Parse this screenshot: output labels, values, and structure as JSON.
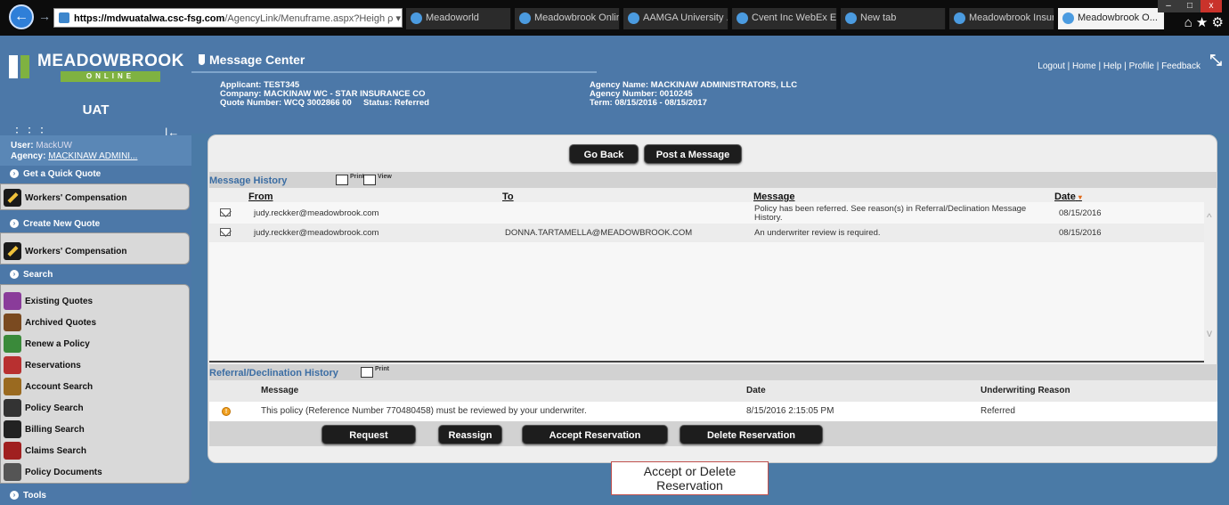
{
  "browser": {
    "url_host": "https://mdwuatalwa.csc-fsg.com",
    "url_path": "/AgencyLink/Menuframe.aspx?Heigh",
    "url_controls": "ρ ▾ 🔒 C",
    "tabs": [
      {
        "label": "Meadoworld",
        "active": false
      },
      {
        "label": "Meadowbrook Online...",
        "active": false
      },
      {
        "label": "AAMGA University ...",
        "active": false
      },
      {
        "label": "Cvent Inc WebEx Ent...",
        "active": false
      },
      {
        "label": "New tab",
        "active": false
      },
      {
        "label": "Meadowbrook Insur...",
        "active": false
      },
      {
        "label": "Meadowbrook O...",
        "active": true
      }
    ],
    "win_ctrls": [
      "–",
      "□",
      "x"
    ]
  },
  "sidebar": {
    "logo_name": "MEADOWBROOK",
    "logo_sub": "ONLINE",
    "env": "UAT",
    "user_label": "User:",
    "user_value": "MackUW",
    "agency_label": "Agency:",
    "agency_value": "MACKINAW ADMINI...",
    "sections": {
      "quick_quote": "Get a Quick Quote",
      "quick_quote_item": "Workers' Compensation",
      "new_quote": "Create New Quote",
      "new_quote_item": "Workers' Compensation",
      "search": "Search",
      "tools": "Tools"
    },
    "search_items": [
      {
        "label": "Existing Quotes",
        "icon": "existing-quotes-icon",
        "color": "#8a3c9a"
      },
      {
        "label": "Archived Quotes",
        "icon": "archived-quotes-icon",
        "color": "#7a4a20"
      },
      {
        "label": "Renew a Policy",
        "icon": "renew-policy-icon",
        "color": "#3a8a3a"
      },
      {
        "label": "Reservations",
        "icon": "reservations-icon",
        "color": "#b83030"
      },
      {
        "label": "Account Search",
        "icon": "account-search-icon",
        "color": "#9a6a20"
      },
      {
        "label": "Policy Search",
        "icon": "policy-search-icon",
        "color": "#333333"
      },
      {
        "label": "Billing Search",
        "icon": "billing-search-icon",
        "color": "#222222"
      },
      {
        "label": "Claims Search",
        "icon": "claims-search-icon",
        "color": "#a02020"
      },
      {
        "label": "Policy Documents",
        "icon": "policy-documents-icon",
        "color": "#555555"
      }
    ]
  },
  "header": {
    "title": "Message Center",
    "links": "Logout | Home | Help | Profile | Feedback",
    "applicant": "Applicant: TEST345",
    "company": "Company: MACKINAW WC - STAR INSURANCE CO",
    "quote_number": "Quote Number: WCQ 3002866 00",
    "status": "Status: Referred",
    "agency_name": "Agency Name: MACKINAW ADMINISTRATORS, LLC",
    "agency_number": "Agency Number: 0010245",
    "term": "Term: 08/15/2016 - 08/15/2017"
  },
  "panel": {
    "go_back": "Go Back",
    "post_message": "Post a Message",
    "history_title": "Message History",
    "print_label": "Print",
    "view_label": "View",
    "columns": {
      "from": "From",
      "to": "To",
      "message": "Message",
      "date": "Date"
    },
    "sort_indicator": "▾",
    "rows": [
      {
        "from": "judy.reckker@meadowbrook.com",
        "to": "",
        "message": "Policy has been referred. See reason(s) in Referral/Declination Message History.",
        "date": "08/15/2016"
      },
      {
        "from": "judy.reckker@meadowbrook.com",
        "to": "DONNA.TARTAMELLA@MEADOWBROOK.COM",
        "message": "An underwriter review is required.",
        "date": "08/15/2016"
      }
    ],
    "ref_title": "Referral/Declination History",
    "ref_columns": {
      "message": "Message",
      "date": "Date",
      "reason": "Underwriting Reason"
    },
    "ref_rows": [
      {
        "message": "This policy (Reference Number 770480458) must be reviewed by your underwriter.",
        "date": "8/15/2016 2:15:05 PM",
        "reason": "Referred"
      }
    ],
    "warn_glyph": "!",
    "actions": {
      "request": "Request",
      "reassign": "Reassign",
      "accept": "Accept Reservation",
      "delete": "Delete Reservation"
    }
  },
  "callout": {
    "line1": "Accept or Delete",
    "line2": "Reservation"
  }
}
